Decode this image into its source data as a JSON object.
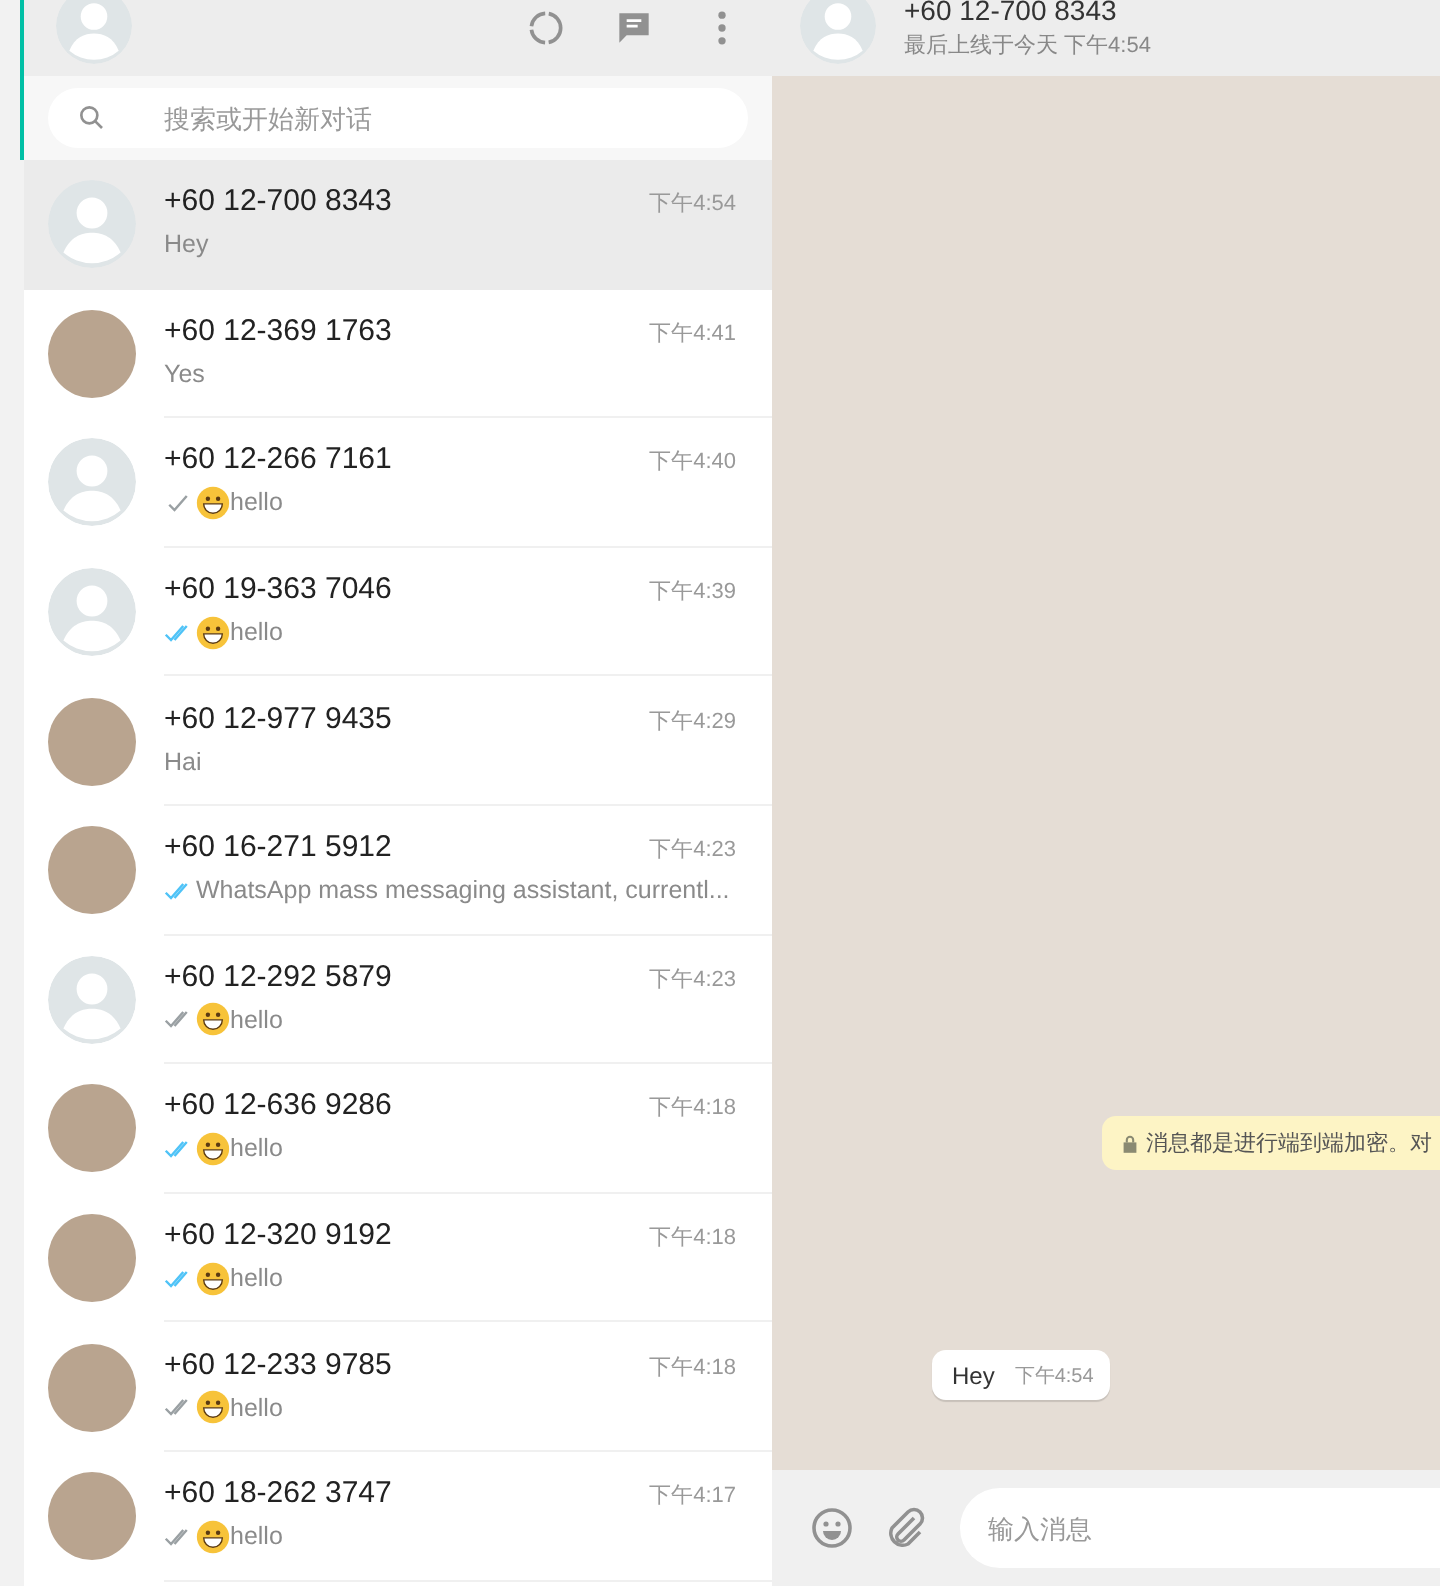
{
  "sidebar": {
    "search": {
      "placeholder": "搜索或开始新对话"
    },
    "chats": [
      {
        "name": "+60 12-700 8343",
        "time": "下午4:54",
        "message": "Hey",
        "sent": false,
        "emoji": false,
        "photo": false,
        "selected": true
      },
      {
        "name": "+60 12-369 1763",
        "time": "下午4:41",
        "message": "Yes",
        "sent": false,
        "emoji": false,
        "photo": true,
        "selected": false
      },
      {
        "name": "+60 12-266 7161",
        "time": "下午4:40",
        "message": "hello",
        "sent": true,
        "delivered": false,
        "read": false,
        "emoji": true,
        "photo": false,
        "selected": false
      },
      {
        "name": "+60 19-363 7046",
        "time": "下午4:39",
        "message": "hello",
        "sent": true,
        "delivered": true,
        "read": true,
        "emoji": true,
        "photo": false,
        "selected": false
      },
      {
        "name": "+60 12-977 9435",
        "time": "下午4:29",
        "message": "Hai",
        "sent": false,
        "emoji": false,
        "photo": true,
        "selected": false
      },
      {
        "name": "+60 16-271 5912",
        "time": "下午4:23",
        "message": "WhatsApp mass messaging assistant, currentl...",
        "sent": true,
        "delivered": true,
        "read": true,
        "emoji": false,
        "photo": true,
        "selected": false
      },
      {
        "name": "+60 12-292 5879",
        "time": "下午4:23",
        "message": "hello",
        "sent": true,
        "delivered": true,
        "read": false,
        "emoji": true,
        "photo": false,
        "selected": false
      },
      {
        "name": "+60 12-636 9286",
        "time": "下午4:18",
        "message": "hello",
        "sent": true,
        "delivered": true,
        "read": true,
        "emoji": true,
        "photo": true,
        "selected": false
      },
      {
        "name": "+60 12-320 9192",
        "time": "下午4:18",
        "message": "hello",
        "sent": true,
        "delivered": true,
        "read": true,
        "emoji": true,
        "photo": true,
        "selected": false
      },
      {
        "name": "+60 12-233 9785",
        "time": "下午4:18",
        "message": "hello",
        "sent": true,
        "delivered": true,
        "read": false,
        "emoji": true,
        "photo": true,
        "selected": false
      },
      {
        "name": "+60 18-262 3747",
        "time": "下午4:17",
        "message": "hello",
        "sent": true,
        "delivered": true,
        "read": false,
        "emoji": true,
        "photo": true,
        "selected": false
      }
    ]
  },
  "conversation": {
    "contact": "+60 12-700 8343",
    "last_seen": "最后上线于今天 下午4:54",
    "notice": "消息都是进行端到端加密。对",
    "messages": [
      {
        "text": "Hey",
        "time": "下午4:54"
      }
    ],
    "composer": {
      "placeholder": "输入消息"
    }
  }
}
